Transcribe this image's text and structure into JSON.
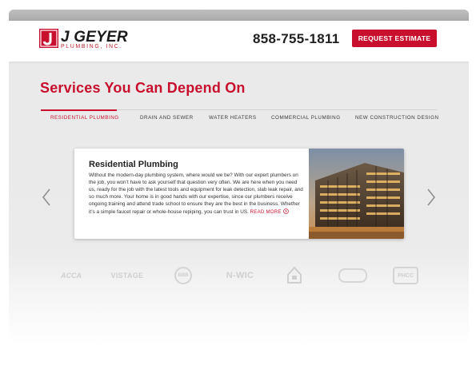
{
  "header": {
    "logo_name": "J GEYER",
    "logo_sub": "PLUMBING, INC.",
    "phone": "858-755-1811",
    "cta_label": "REQUEST ESTIMATE"
  },
  "section": {
    "title": "Services You Can Depend On"
  },
  "tabs": [
    {
      "label": "RESIDENTIAL PLUMBING",
      "active": true
    },
    {
      "label": "DRAIN AND SEWER",
      "active": false
    },
    {
      "label": "WATER HEATERS",
      "active": false
    },
    {
      "label": "COMMERCIAL PLUMBING",
      "active": false
    },
    {
      "label": "NEW CONSTRUCTION DESIGN",
      "active": false
    }
  ],
  "card": {
    "title": "Residential Plumbing",
    "body": "Without the modern-day plumbing system, where would we be? With our expert plumbers on the job, you won’t have to ask yourself that question very often. We are here when you need us, ready for the job with the latest tools and equipment for leak detection, slab leak repair, and so much more. Your home is in good hands with our expertise, since our plumbers receive ongoing training and attend trade school to ensure they are the best in the business. Whether it’s a simple faucet repair or whole-house repiping, you can trust in US.",
    "read_more": "READ MORE"
  },
  "badges": [
    {
      "label": "ACCA"
    },
    {
      "label": "VISTAGE"
    },
    {
      "label": "BBB"
    },
    {
      "label": "N-WIC"
    },
    {
      "label": ""
    },
    {
      "label": ""
    },
    {
      "label": "PHCC"
    }
  ],
  "colors": {
    "brand_red": "#c8102e",
    "text_dark": "#1f1f1f",
    "badge_gray": "#cfcfcf"
  },
  "icons": {
    "carousel_prev": "chevron-left-icon",
    "carousel_next": "chevron-right-icon",
    "read_more": "circle-arrow-icon"
  }
}
